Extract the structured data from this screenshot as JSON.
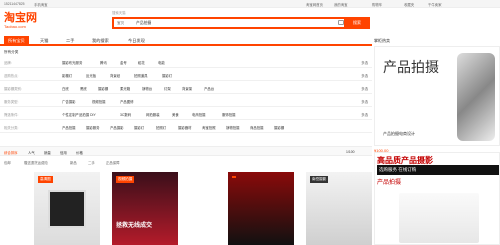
{
  "topbar": {
    "left": "15211447825",
    "left2": "手机淘宝",
    "right1": "淘宝网首页",
    "right2": "我的淘宝",
    "right3": "购物车",
    "right4": "收藏夹",
    "right5": "千牛卖家"
  },
  "logo": {
    "cn": "淘宝网",
    "en": "Taobao.com"
  },
  "search": {
    "category": "宝贝",
    "value": "产品拍摄",
    "button": "搜索",
    "above": "搜索天猫"
  },
  "nav": {
    "tabs": [
      "所有宝贝",
      "天猫",
      "二手",
      "我的搜索",
      "今日发现"
    ]
  },
  "filters": {
    "title": "所有分类",
    "rows": [
      {
        "key": "品牌:",
        "values": [
          "摄影布光服务",
          "腾讯",
          "金号",
          "稻花",
          "电能"
        ],
        "more": "多选"
      },
      {
        "key": "选购热点:",
        "values": [
          "影棚灯",
          "反光板",
          "背景纸",
          "拍照道具",
          "摄影灯"
        ],
        "more": "多选"
      },
      {
        "key": "摄影棚类别:",
        "values": [
          "白底",
          "黑底",
          "摄影棚",
          "柔光箱",
          "静物台",
          "灯架",
          "背景架",
          "产品台"
        ],
        "more": "多选"
      },
      {
        "key": "服务类型:",
        "values": [
          "广告摄影",
          "视频拍摄",
          "产品图修"
        ],
        "more": "多选"
      },
      {
        "key": "筛选条件:",
        "values": [
          "个性定制产品拍摄 DIY",
          "3C数码",
          "网拍服装",
          "美食",
          "电商拍摄",
          "服饰拍摄"
        ],
        "more": "多选"
      },
      {
        "key": "相关分类:",
        "values": [
          "产品拍摄",
          "摄影服务",
          "产品摄影",
          "摄影灯",
          "拍照灯",
          "摄影器材",
          "淘宝拍照",
          "静物拍摄",
          "商品拍摄",
          "摄影棚"
        ],
        "more": ""
      }
    ]
  },
  "sortbar": {
    "items": [
      "综合排序",
      "人气",
      "销量",
      "信用",
      "价格"
    ],
    "pager": "1/100"
  },
  "filter2": {
    "items": [
      "包邮",
      "赠送退货运费险",
      "新品",
      "二手",
      "正品保障"
    ]
  },
  "products": [
    {
      "badge": "高清图",
      "label": ""
    },
    {
      "badge": "视频拍摄",
      "label": "拯救无线成交"
    },
    {
      "badge": "",
      "label": ""
    },
    {
      "badge": "南岳摄影",
      "label": ""
    }
  ],
  "rightcol": {
    "title": "掌柜热卖",
    "ad1_text": "产品拍摄",
    "ad1_sub": "产品拍摄电商设计",
    "price1": "¥100.00",
    "ad2_t1": "高品质产品摄影",
    "ad2_t2": "选购服务 在线订购",
    "ad2_t3": "产品拍摄"
  }
}
